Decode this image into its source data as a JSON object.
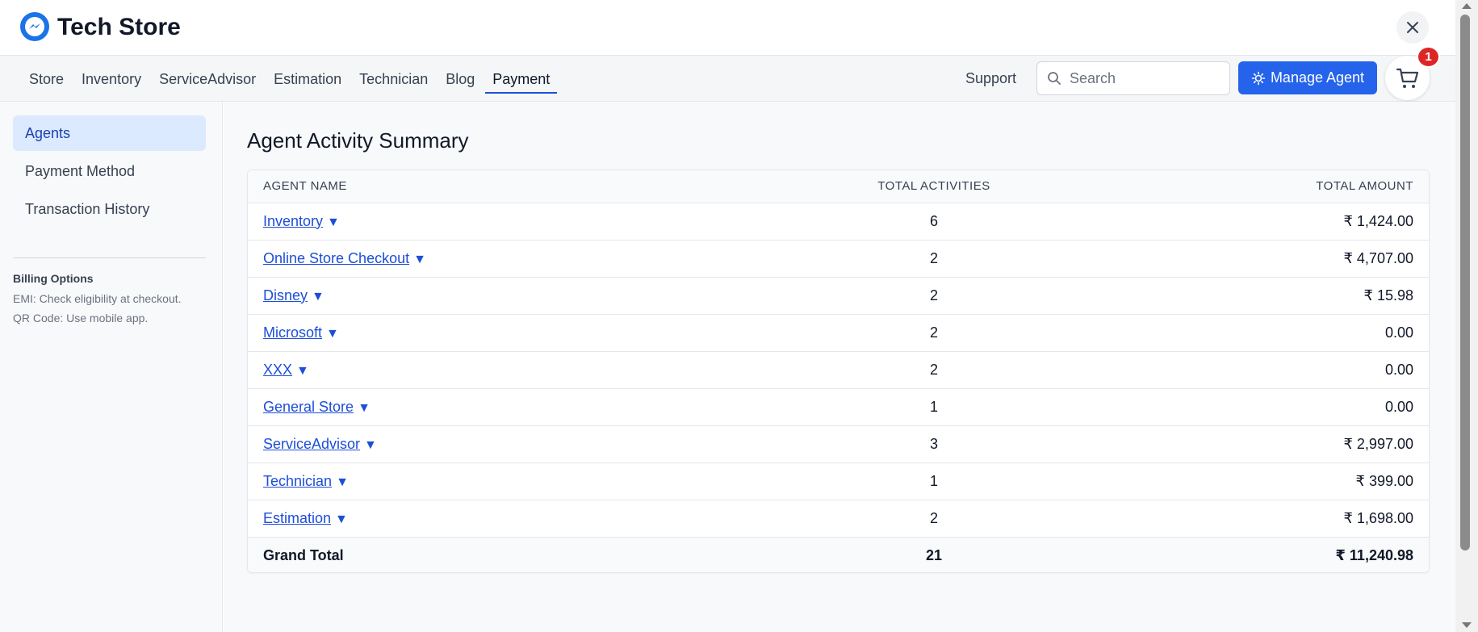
{
  "app": {
    "title": "Tech Store"
  },
  "nav": {
    "tabs": [
      {
        "label": "Store"
      },
      {
        "label": "Inventory"
      },
      {
        "label": "ServiceAdvisor"
      },
      {
        "label": "Estimation"
      },
      {
        "label": "Technician"
      },
      {
        "label": "Blog"
      },
      {
        "label": "Payment"
      }
    ],
    "active_tab": "Payment",
    "support_label": "Support",
    "search_placeholder": "Search",
    "manage_agent_label": "Manage Agent",
    "cart_count": "1"
  },
  "sidebar": {
    "items": [
      {
        "label": "Agents"
      },
      {
        "label": "Payment Method"
      },
      {
        "label": "Transaction History"
      }
    ],
    "active_item": "Agents",
    "billing_title": "Billing Options",
    "billing_lines": [
      "EMI: Check eligibility at checkout.",
      "QR Code: Use mobile app."
    ]
  },
  "main": {
    "title": "Agent Activity Summary",
    "table": {
      "headers": [
        "AGENT NAME",
        "TOTAL ACTIVITIES",
        "TOTAL AMOUNT"
      ],
      "rows": [
        {
          "name": "Inventory",
          "activities": "6",
          "amount": "₹ 1,424.00"
        },
        {
          "name": "Online Store Checkout",
          "activities": "2",
          "amount": "₹ 4,707.00"
        },
        {
          "name": "Disney",
          "activities": "2",
          "amount": "₹ 15.98"
        },
        {
          "name": "Microsoft",
          "activities": "2",
          "amount": "0.00"
        },
        {
          "name": "XXX",
          "activities": "2",
          "amount": "0.00"
        },
        {
          "name": "General Store",
          "activities": "1",
          "amount": "0.00"
        },
        {
          "name": "ServiceAdvisor",
          "activities": "3",
          "amount": "₹ 2,997.00"
        },
        {
          "name": "Technician",
          "activities": "1",
          "amount": "₹ 399.00"
        },
        {
          "name": "Estimation",
          "activities": "2",
          "amount": "₹ 1,698.00"
        }
      ],
      "total": {
        "label": "Grand Total",
        "activities": "21",
        "amount": "₹ 11,240.98"
      },
      "caret": "▼"
    }
  },
  "colors": {
    "primary": "#2563eb",
    "link": "#1d4ed8",
    "badge": "#dc2626",
    "sidebar_active_bg": "#dbeafe"
  }
}
